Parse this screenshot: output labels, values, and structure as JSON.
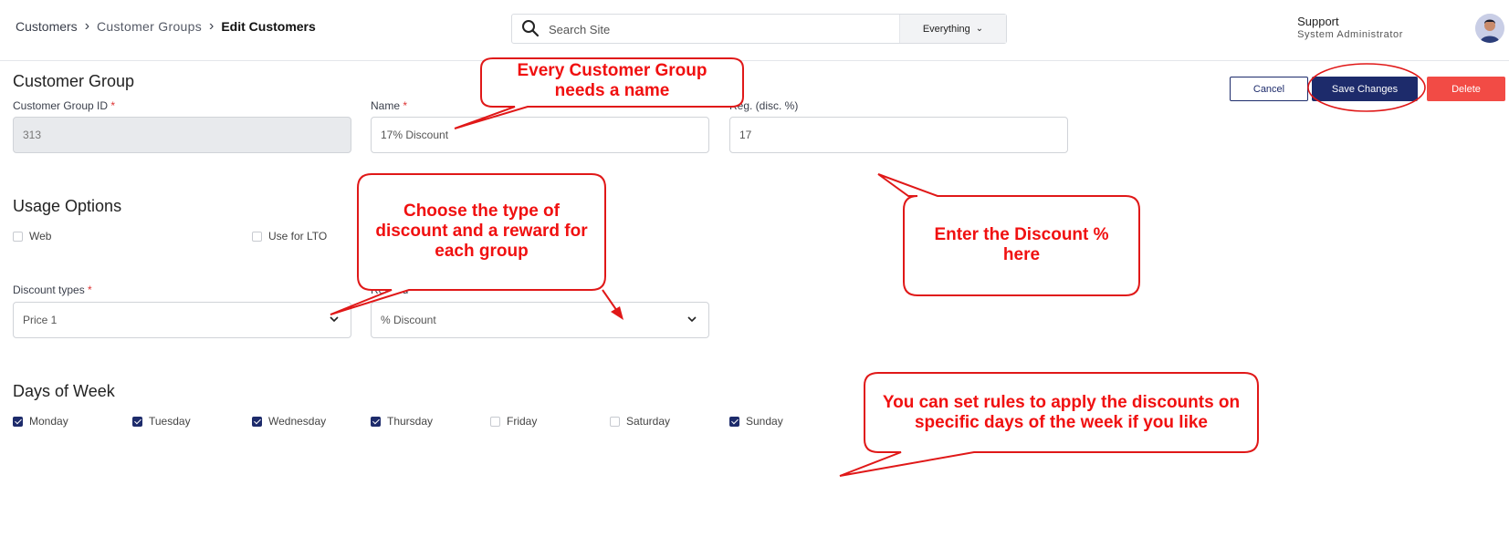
{
  "breadcrumb": {
    "items": [
      "Customers",
      "Customer Groups",
      "Edit Customers"
    ]
  },
  "search": {
    "placeholder": "Search Site",
    "scope": "Everything"
  },
  "user": {
    "name": "Support",
    "role": "System Administrator"
  },
  "form": {
    "title": "Customer Group",
    "group_id": {
      "label": "Customer Group ID",
      "value": "313"
    },
    "name": {
      "label": "Name",
      "value": "17% Discount"
    },
    "reg_disc": {
      "label": "Reg. (disc. %)",
      "value": "17"
    },
    "required_mark": "*"
  },
  "buttons": {
    "cancel": "Cancel",
    "save": "Save Changes",
    "delete": "Delete"
  },
  "usage": {
    "title": "Usage Options",
    "web": "Web",
    "lto": "Use for LTO",
    "web_checked": false,
    "lto_checked": false
  },
  "discount": {
    "types_label": "Discount types",
    "types_value": "Price 1",
    "reward_label": "Reward",
    "reward_value": "% Discount"
  },
  "days": {
    "title": "Days of Week",
    "items": [
      {
        "label": "Monday",
        "checked": true
      },
      {
        "label": "Tuesday",
        "checked": true
      },
      {
        "label": "Wednesday",
        "checked": true
      },
      {
        "label": "Thursday",
        "checked": true
      },
      {
        "label": "Friday",
        "checked": false
      },
      {
        "label": "Saturday",
        "checked": false
      },
      {
        "label": "Sunday",
        "checked": true
      }
    ]
  },
  "callouts": {
    "name": [
      "Every Customer Group",
      "needs a name"
    ],
    "discount_type": [
      "Choose the type of",
      "discount and a reward for",
      "each group"
    ],
    "discount_pct": [
      "Enter the Discount %",
      "here"
    ],
    "days": [
      "You can set rules to apply the discounts on",
      "specific days of the week if you like"
    ]
  },
  "colors": {
    "accent": "#1d2b6b",
    "danger": "#f24b45",
    "annotation": "#f01010"
  }
}
